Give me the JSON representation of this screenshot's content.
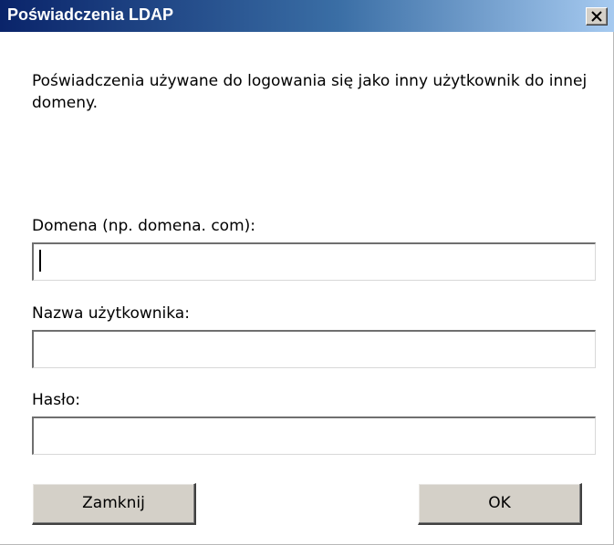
{
  "dialog": {
    "title": "Poświadczenia LDAP",
    "close_icon": "close-icon",
    "description": "Poświadczenia używane do logowania się jako inny użytkownik do innej domeny."
  },
  "fields": {
    "domain": {
      "label": "Domena (np. domena. com):",
      "value": ""
    },
    "username": {
      "label": "Nazwa użytkownika:",
      "value": ""
    },
    "password": {
      "label": "Hasło:",
      "value": ""
    }
  },
  "buttons": {
    "close_label": "Zamknij",
    "ok_label": "OK"
  },
  "colors": {
    "titlebar_start": "#0a246a",
    "titlebar_end": "#a6caf0",
    "button_face": "#d4d0c8"
  }
}
